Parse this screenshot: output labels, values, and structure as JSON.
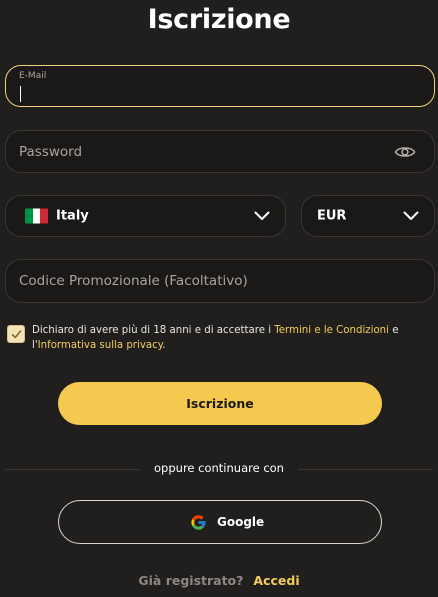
{
  "header": {
    "title": "Iscrizione"
  },
  "email": {
    "label": "E-Mail",
    "value": ""
  },
  "password": {
    "placeholder": "Password",
    "toggle_icon": "eye-icon"
  },
  "country": {
    "value": "Italy",
    "flag_colors": [
      "#009246",
      "#ffffff",
      "#ce2b37"
    ],
    "icon": "chevron-down-icon"
  },
  "currency": {
    "value": "EUR",
    "icon": "chevron-down-icon"
  },
  "promo": {
    "placeholder": "Codice Promozionale (Facoltativo)"
  },
  "consent": {
    "checked": true,
    "text_before": "Dichiaro di avere più di 18 anni e di accettare i ",
    "terms_link": "Termini e le Condizioni",
    "text_middle": " e l'",
    "privacy_link": "Informativa sulla privacy",
    "text_after": "."
  },
  "submit": {
    "label": "Iscrizione"
  },
  "social": {
    "separator": "oppure continuare con",
    "google_label": "Google",
    "google_icon": "google-icon"
  },
  "footer": {
    "question": "Già registrato?",
    "login_link": "Accedi"
  },
  "colors": {
    "accent": "#f5c84f",
    "link": "#f2cc5e",
    "background": "#211f1e",
    "field_border_active": "#f2d27a"
  }
}
